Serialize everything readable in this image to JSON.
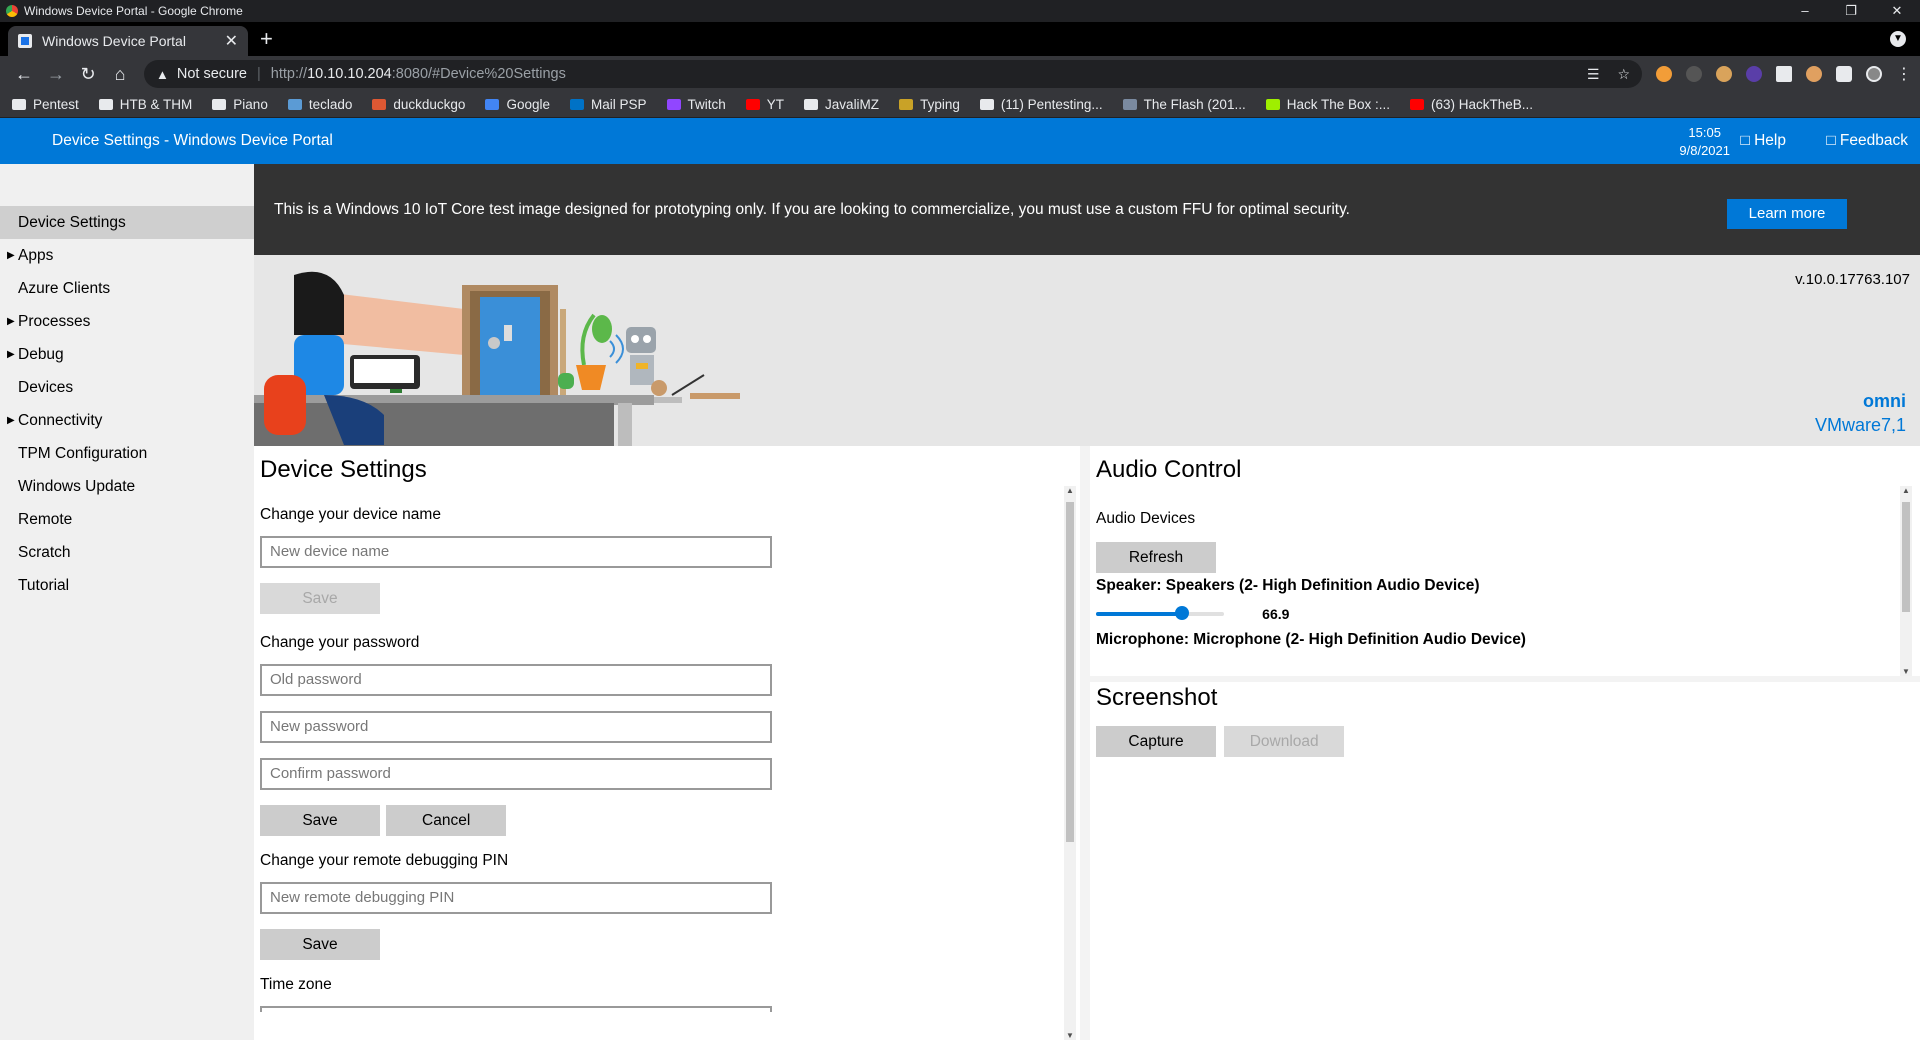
{
  "window": {
    "title": "Windows Device Portal - Google Chrome"
  },
  "tab": {
    "title": "Windows Device Portal"
  },
  "address": {
    "security": "Not secure",
    "host": "10.10.10.204",
    "rest": ":8080/#Device%20Settings",
    "prefix": "http://"
  },
  "bookmarks": [
    {
      "label": "Pentest",
      "color": "#e8eaed"
    },
    {
      "label": "HTB & THM",
      "color": "#e8eaed"
    },
    {
      "label": "Piano",
      "color": "#e8eaed"
    },
    {
      "label": "teclado",
      "color": "#5b9bd5"
    },
    {
      "label": "duckduckgo",
      "color": "#de5833"
    },
    {
      "label": "Google",
      "color": "#4285f4"
    },
    {
      "label": "Mail PSP",
      "color": "#0072c6"
    },
    {
      "label": "Twitch",
      "color": "#9146ff"
    },
    {
      "label": "YT",
      "color": "#ff0000"
    },
    {
      "label": "JavaliMZ",
      "color": "#e8eaed"
    },
    {
      "label": "Typing",
      "color": "#c9a227"
    },
    {
      "label": "(11) Pentesting...",
      "color": "#e8eaed"
    },
    {
      "label": "The Flash (201...",
      "color": "#7a8aa0"
    },
    {
      "label": "Hack The Box :...",
      "color": "#9fef00"
    },
    {
      "label": "(63) HackTheB...",
      "color": "#ff0000"
    }
  ],
  "header": {
    "title": "Device Settings - Windows Device Portal",
    "time": "15:05",
    "date": "9/8/2021",
    "help": "Help",
    "feedback": "Feedback"
  },
  "sidebar": {
    "items": [
      {
        "label": "Device Settings",
        "arrow": false
      },
      {
        "label": "Apps",
        "arrow": true
      },
      {
        "label": "Azure Clients",
        "arrow": false
      },
      {
        "label": "Processes",
        "arrow": true
      },
      {
        "label": "Debug",
        "arrow": true
      },
      {
        "label": "Devices",
        "arrow": false
      },
      {
        "label": "Connectivity",
        "arrow": true
      },
      {
        "label": "TPM Configuration",
        "arrow": false
      },
      {
        "label": "Windows Update",
        "arrow": false
      },
      {
        "label": "Remote",
        "arrow": false
      },
      {
        "label": "Scratch",
        "arrow": false
      },
      {
        "label": "Tutorial",
        "arrow": false
      }
    ]
  },
  "banner": {
    "text": "This is a Windows 10 IoT Core test image designed for prototyping only. If you are looking to commercialize, you must use a custom FFU for optimal security.",
    "learn_more": "Learn more"
  },
  "hero": {
    "version": "v.10.0.17763.107",
    "device_name": "omni",
    "device_model": "VMware7,1"
  },
  "device_settings": {
    "title": "Device Settings",
    "name_label": "Change your device name",
    "name_placeholder": "New device name",
    "save": "Save",
    "password_label": "Change your password",
    "old_pw": "Old password",
    "new_pw": "New password",
    "confirm_pw": "Confirm password",
    "cancel": "Cancel",
    "pin_label": "Change your remote debugging PIN",
    "pin_placeholder": "New remote debugging PIN",
    "timezone_label": "Time zone"
  },
  "audio": {
    "title": "Audio Control",
    "devices_label": "Audio Devices",
    "refresh": "Refresh",
    "speaker": "Speaker: Speakers (2- High Definition Audio Device)",
    "speaker_volume": "66.9",
    "speaker_level": 0.669,
    "microphone": "Microphone: Microphone (2- High Definition Audio Device)"
  },
  "screenshot": {
    "title": "Screenshot",
    "capture": "Capture",
    "download": "Download"
  }
}
